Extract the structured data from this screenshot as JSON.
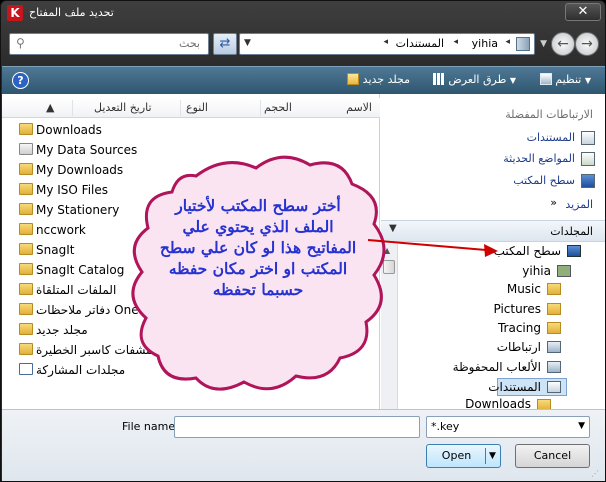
{
  "window": {
    "title": "تحديد ملف المفتاح",
    "close_glyph": "✕"
  },
  "address": {
    "crumbs": [
      "yihia",
      "المستندات"
    ],
    "search_placeholder": "بحث"
  },
  "toolbar": {
    "organize": "تنظيم",
    "views": "طرق العرض",
    "new_folder": "مجلد جديد"
  },
  "columns": {
    "name": "الاسم",
    "date_modified": "تاريخ التعديل",
    "type": "النوع",
    "size": "الحجم"
  },
  "files": [
    {
      "name": "Downloads",
      "icon": "folder"
    },
    {
      "name": "My Data Sources",
      "icon": "special-folder"
    },
    {
      "name": "My Downloads",
      "icon": "folder"
    },
    {
      "name": "My ISO Files",
      "icon": "folder"
    },
    {
      "name": "My Stationery",
      "icon": "folder"
    },
    {
      "name": "nccwork",
      "icon": "folder"
    },
    {
      "name": "SnagIt",
      "icon": "folder"
    },
    {
      "name": "SnagIt Catalog",
      "icon": "folder"
    },
    {
      "name": "الملفات المتلقاة",
      "icon": "folder"
    },
    {
      "name": "دفاتر ملاحظات OneNote",
      "icon": "folder"
    },
    {
      "name": "مجلد جديد",
      "icon": "folder"
    },
    {
      "name": "معزل لمكتشفات كاسبر الخطيرة",
      "icon": "folder"
    },
    {
      "name": "مجلدات المشاركة",
      "icon": "shortcut"
    }
  ],
  "favorites": {
    "heading": "الارتباطات المفضلة",
    "links": [
      "المستندات",
      "المواضع الحديثة",
      "سطح المكتب"
    ],
    "more": "المزيد"
  },
  "folders": {
    "label": "المجلدات",
    "tree": [
      "سطح المكتب",
      "yihia",
      "Music",
      "Pictures",
      "Tracing",
      "ارتباطات",
      "الألعاب المحفوظة",
      "المستندات",
      "Downloads"
    ]
  },
  "bottom": {
    "file_name_label": "File name:",
    "file_name_value": "",
    "file_type_value": "*.key",
    "open_label": "Open",
    "cancel_label": "Cancel"
  },
  "callout": {
    "text": "أختر سطح المكتب لأختيار الملف الذي يحتوي علي المفاتيح هذا لو كان علي سطح المكتب او اختر مكان حفظه حسبما تحفظه"
  }
}
